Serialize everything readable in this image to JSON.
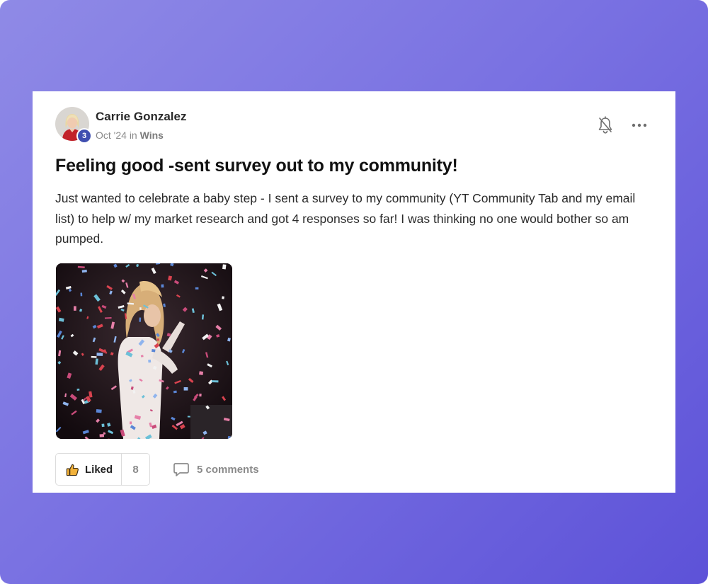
{
  "post": {
    "author": {
      "name": "Carrie Gonzalez",
      "level": "3"
    },
    "meta": {
      "date": "Oct '24",
      "in_word": "in",
      "category": "Wins"
    },
    "title": "Feeling good -sent survey out to my community!",
    "body": "Just wanted to celebrate a baby step - I sent a survey to my community (YT Community Tab and my email list) to help w/ my market research and got 4 responses so far! I was thinking no one would bother so am pumped.",
    "actions": {
      "like_label": "Liked",
      "like_count": "8",
      "comments_label": "5 comments"
    },
    "icons": {
      "bell": "bell-off-icon",
      "more": "more-horizontal-icon",
      "like": "thumbs-up-icon",
      "comment": "comment-icon"
    }
  },
  "colors": {
    "background_gradient_start": "#8f8ae6",
    "background_gradient_end": "#5d52d8",
    "level_badge": "#3f4fb0",
    "like_icon": "#f2b23a"
  }
}
